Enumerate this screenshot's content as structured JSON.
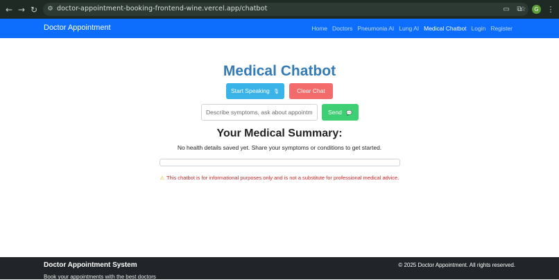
{
  "browser": {
    "url": "doctor-appointment-booking-frontend-wine.vercel.app/chatbot",
    "profile_initial": "G",
    "icons": [
      "back-icon",
      "forward-icon",
      "reload-icon",
      "site-settings-icon",
      "cast-icon",
      "bookmark-star-icon",
      "extensions-icon",
      "menu-icon"
    ]
  },
  "navbar": {
    "brand": "Doctor Appointment",
    "links": [
      "Home",
      "Doctors",
      "Pneumonia AI",
      "Lung AI",
      "Medical Chatbot",
      "Login",
      "Register"
    ],
    "active": "Medical Chatbot"
  },
  "main": {
    "title": "Medical Chatbot",
    "speak_label": "Start Speaking",
    "speak_icon": "microphone-icon",
    "clear_label": "Clear Chat",
    "input_placeholder": "Describe symptoms, ask about appointme",
    "send_label": "Send",
    "send_icon": "chat-icon",
    "summary_heading": "Your Medical Summary:",
    "summary_text": "No health details saved yet. Share your symptoms or conditions to get started.",
    "disclaimer": "This chatbot is for informational purposes only and is not a substitute for professional medical advice."
  },
  "footer": {
    "brand": "Doctor Appointment System",
    "subtitle": "Book your appointments with the best doctors",
    "copyright": "© 2025 Doctor Appointment. All rights reserved."
  },
  "colors": {
    "navbar": "#0d6efd",
    "title": "#337ab7",
    "speak_button": "#3ab4e8",
    "clear_button": "#f36b6b",
    "send_button": "#3ecf74",
    "footer": "#212529",
    "disclaimer": "#c62828"
  }
}
